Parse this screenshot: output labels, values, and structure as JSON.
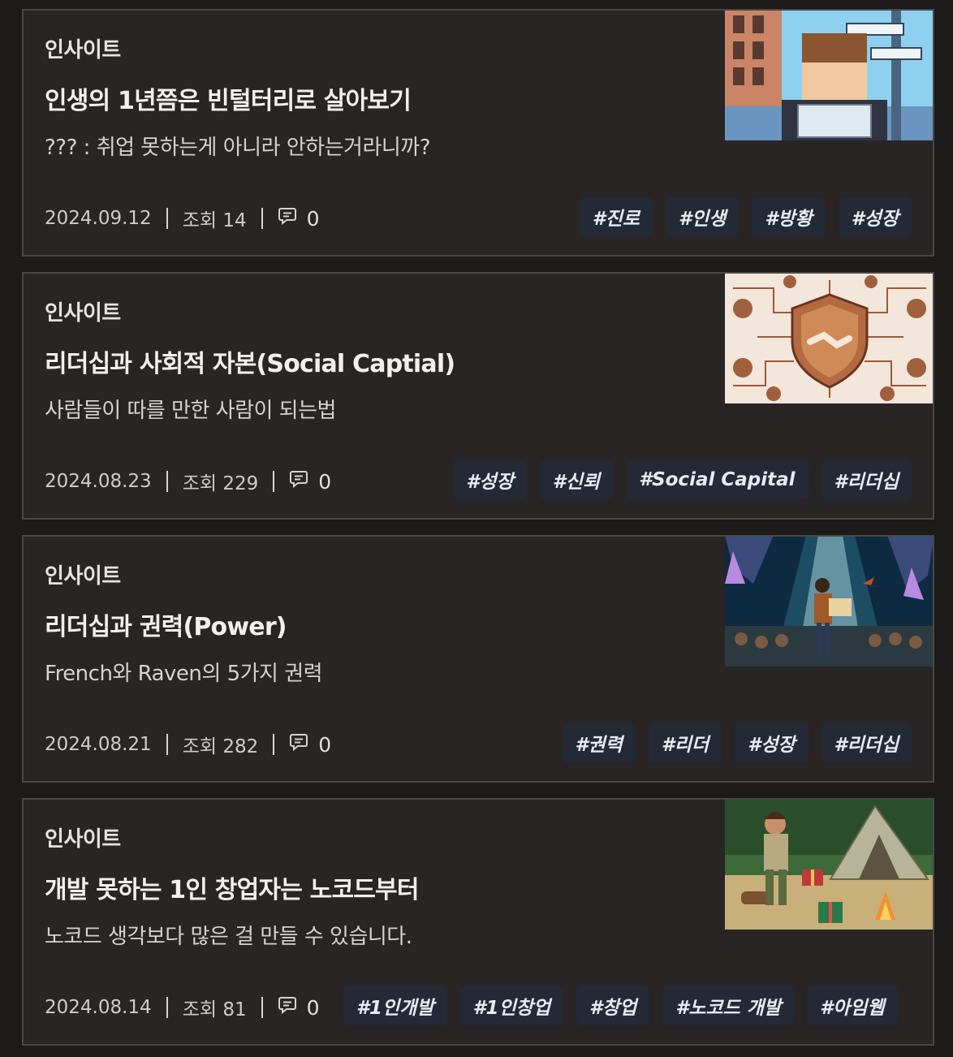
{
  "posts": [
    {
      "category": "인사이트",
      "title": "인생의 1년쯤은 빈털터리로 살아보기",
      "summary": " ??? : 취업 못하는게 아니라 안하는거라니까?",
      "date": "2024.09.12",
      "views": "조회 14",
      "comments": "0",
      "tags": [
        "#진로",
        "#인생",
        "#방황",
        "#성장"
      ]
    },
    {
      "category": "인사이트",
      "title": "리더십과 사회적 자본(Social Captial)",
      "summary": "사람들이 따를 만한 사람이 되는법",
      "date": "2024.08.23",
      "views": "조회 229",
      "comments": "0",
      "tags": [
        "#성장",
        "#신뢰",
        "#Social Capital",
        "#리더십"
      ]
    },
    {
      "category": "인사이트",
      "title": "리더십과 권력(Power)",
      "summary": "French와 Raven의 5가지 권력",
      "date": "2024.08.21",
      "views": "조회 282",
      "comments": "0",
      "tags": [
        "#권력",
        "#리더",
        "#성장",
        "#리더십"
      ]
    },
    {
      "category": "인사이트",
      "title": "개발 못하는 1인 창업자는 노코드부터",
      "summary": "노코드 생각보다 많은 걸 만들 수 있습니다.",
      "date": "2024.08.14",
      "views": "조회 81",
      "comments": "0",
      "tags": [
        "#1인개발",
        "#1인창업",
        "#창업",
        "#노코드 개발",
        "#아임웹"
      ]
    }
  ],
  "icons": {
    "comment": "comment-icon"
  },
  "colors": {
    "background": "#1d1b1a",
    "card": "#282524",
    "border": "#4a4745",
    "tag_bg": "#232a35"
  }
}
